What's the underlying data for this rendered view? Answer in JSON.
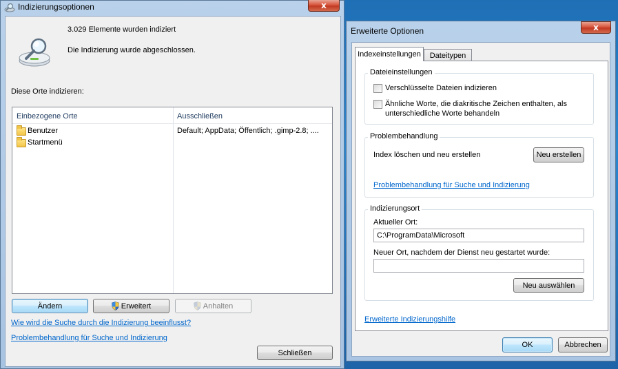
{
  "win1": {
    "title": "Indizierungsoptionen",
    "close_glyph": "x",
    "status": {
      "count_text": "3.029 Elemente wurden indiziert",
      "done_text": "Die Indizierung wurde abgeschlossen."
    },
    "locations_label": "Diese Orte indizieren:",
    "list": {
      "columns": [
        "Einbezogene Orte",
        "Ausschließen"
      ],
      "rows": [
        {
          "name": "Benutzer",
          "exclude": "Default; AppData; Öffentlich; .gimp-2.8; ...."
        },
        {
          "name": "Startmenü",
          "exclude": ""
        }
      ]
    },
    "buttons": {
      "aendern": "Ändern",
      "erweitert": "Erweitert",
      "anhalten": "Anhalten",
      "schliessen": "Schließen"
    },
    "links": {
      "how_search": "Wie wird die Suche durch die Indizierung beeinflusst?",
      "troubleshoot": "Problembehandlung für Suche und Indizierung"
    }
  },
  "win2": {
    "title": "Erweiterte Optionen",
    "close_glyph": "x",
    "tabs": [
      "Indexeinstellungen",
      "Dateitypen"
    ],
    "file_settings": {
      "title": "Dateieinstellungen",
      "encrypted_label": "Verschlüsselte Dateien indizieren",
      "diacritics_line1": "Ähnliche Worte, die diakritische Zeichen enthalten, als",
      "diacritics_line2": "unterschiedliche Worte behandeln",
      "encrypted_checked": false,
      "diacritics_checked": false
    },
    "troubleshooting": {
      "title": "Problembehandlung",
      "rebuild_label": "Index löschen und neu erstellen",
      "rebuild_button": "Neu erstellen",
      "link": "Problembehandlung für Suche und Indizierung"
    },
    "location": {
      "title": "Indizierungsort",
      "current_label": "Aktueller Ort:",
      "current_value": "C:\\ProgramData\\Microsoft",
      "new_label": "Neuer Ort, nachdem der Dienst neu gestartet wurde:",
      "new_value": "",
      "select_button": "Neu auswählen"
    },
    "help_link": "Erweiterte Indizierungshilfe",
    "ok_button": "OK",
    "cancel_button": "Abbrechen"
  }
}
